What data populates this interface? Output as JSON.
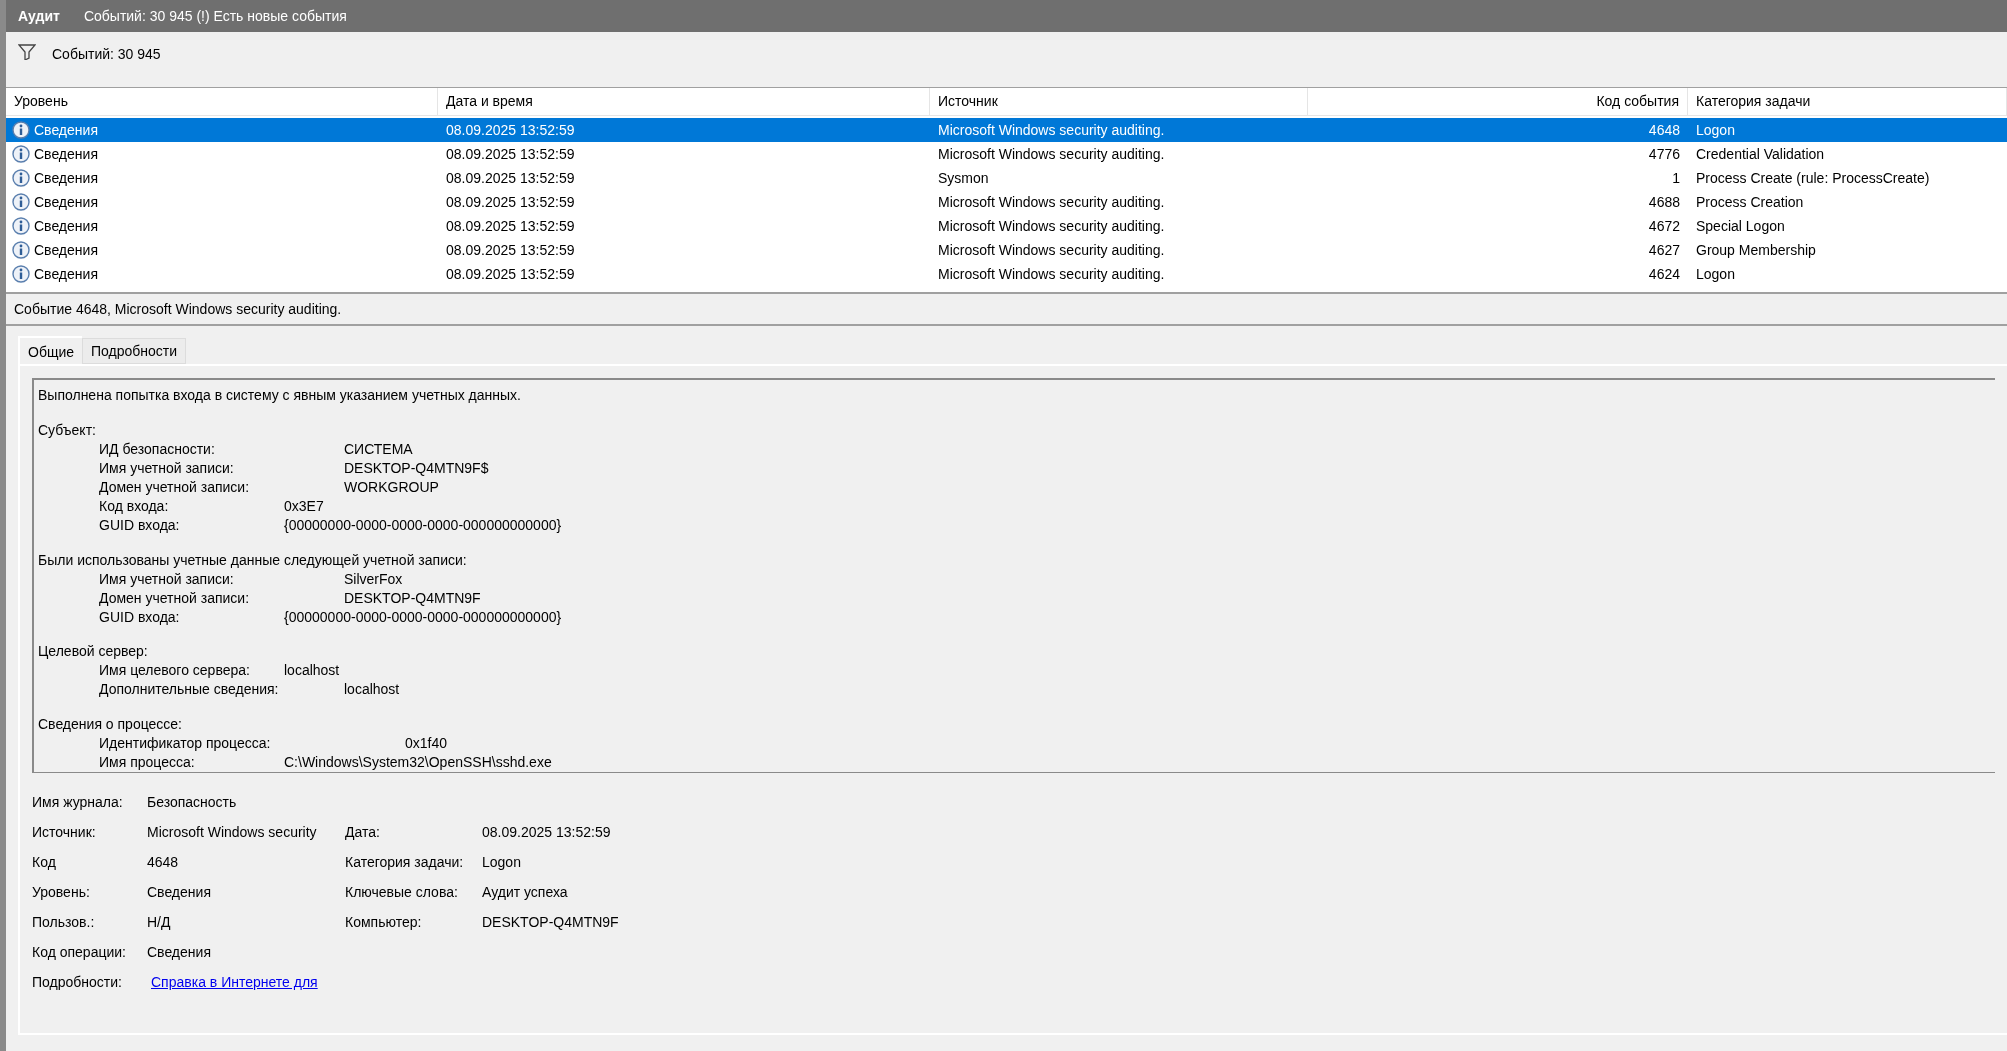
{
  "header": {
    "title": "Аудит",
    "status": "Событий: 30 945 (!) Есть новые события"
  },
  "filter_bar": {
    "count": "Событий: 30 945"
  },
  "table": {
    "columns": [
      "Уровень",
      "Дата и время",
      "Источник",
      "Код события",
      "Категория задачи"
    ],
    "rows": [
      {
        "level": "Сведения",
        "date": "08.09.2025 13:52:59",
        "source": "Microsoft Windows security auditing.",
        "event_id": "4648",
        "category": "Logon",
        "selected": true
      },
      {
        "level": "Сведения",
        "date": "08.09.2025 13:52:59",
        "source": "Microsoft Windows security auditing.",
        "event_id": "4776",
        "category": "Credential Validation",
        "selected": false
      },
      {
        "level": "Сведения",
        "date": "08.09.2025 13:52:59",
        "source": "Sysmon",
        "event_id": "1",
        "category": "Process Create (rule: ProcessCreate)",
        "selected": false
      },
      {
        "level": "Сведения",
        "date": "08.09.2025 13:52:59",
        "source": "Microsoft Windows security auditing.",
        "event_id": "4688",
        "category": "Process Creation",
        "selected": false
      },
      {
        "level": "Сведения",
        "date": "08.09.2025 13:52:59",
        "source": "Microsoft Windows security auditing.",
        "event_id": "4672",
        "category": "Special Logon",
        "selected": false
      },
      {
        "level": "Сведения",
        "date": "08.09.2025 13:52:59",
        "source": "Microsoft Windows security auditing.",
        "event_id": "4627",
        "category": "Group Membership",
        "selected": false
      },
      {
        "level": "Сведения",
        "date": "08.09.2025 13:52:59",
        "source": "Microsoft Windows security auditing.",
        "event_id": "4624",
        "category": "Logon",
        "selected": false
      }
    ]
  },
  "details": {
    "title": "Событие 4648, Microsoft Windows security auditing.",
    "tabs": [
      {
        "label": "Общие",
        "selected": true
      },
      {
        "label": "Подробности",
        "selected": false
      }
    ],
    "description": {
      "summary": "Выполнена попытка входа в систему с явным указанием учетных данных.",
      "sections": [
        {
          "title": "Субъект:",
          "fields": [
            {
              "label": "ИД безопасности:",
              "value": "СИСТЕМА"
            },
            {
              "label": "Имя учетной записи:",
              "value": "DESKTOP-Q4MTN9F$"
            },
            {
              "label": "Домен учетной записи:",
              "value": "WORKGROUP"
            },
            {
              "label": "Код входа:",
              "value": "0x3E7"
            },
            {
              "label": "GUID входа:",
              "value": "{00000000-0000-0000-0000-000000000000}"
            }
          ]
        },
        {
          "title": "Были использованы учетные данные следующей учетной записи:",
          "fields": [
            {
              "label": "Имя учетной записи:",
              "value": "SilverFox"
            },
            {
              "label": "Домен учетной записи:",
              "value": "DESKTOP-Q4MTN9F"
            },
            {
              "label": "GUID входа:",
              "value": "{00000000-0000-0000-0000-000000000000}"
            }
          ]
        },
        {
          "title": "Целевой сервер:",
          "fields": [
            {
              "label": "Имя целевого сервера:",
              "value": "localhost"
            },
            {
              "label": "Дополнительные сведения:",
              "value": "localhost"
            }
          ]
        },
        {
          "title": "Сведения о процессе:",
          "fields": [
            {
              "label": "Идентификатор процесса:",
              "value": "0x1f40"
            },
            {
              "label": "Имя процесса:",
              "value": "C:\\Windows\\System32\\OpenSSH\\sshd.exe"
            }
          ]
        }
      ]
    },
    "properties": [
      {
        "label": "Имя журнала:",
        "value": "Безопасность",
        "kind": "text"
      },
      {
        "label": "Источник:",
        "value": "Microsoft Windows security",
        "kind": "text",
        "right": {
          "label": "Дата:",
          "value": "08.09.2025 13:52:59"
        }
      },
      {
        "label": "Код",
        "value": "4648",
        "kind": "text",
        "right": {
          "label": "Категория задачи:",
          "value": "Logon"
        }
      },
      {
        "label": "Уровень:",
        "value": "Сведения",
        "kind": "text",
        "right": {
          "label": "Ключевые слова:",
          "value": "Аудит успеха"
        }
      },
      {
        "label": "Пользов.:",
        "value": "Н/Д",
        "kind": "text",
        "right": {
          "label": "Компьютер:",
          "value": "DESKTOP-Q4MTN9F"
        }
      },
      {
        "label": "Код операции:",
        "value": "Сведения",
        "kind": "text"
      },
      {
        "label": "Подробности:",
        "value": "Справка в Интернете для",
        "kind": "link"
      }
    ]
  }
}
